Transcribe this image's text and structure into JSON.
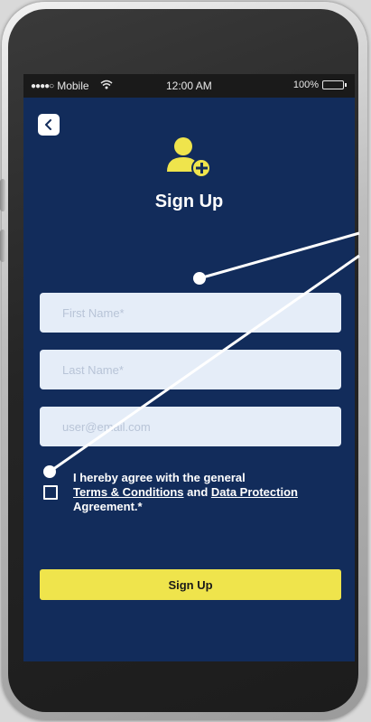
{
  "status_bar": {
    "carrier": "Mobile",
    "time": "12:00 AM",
    "battery": "100%"
  },
  "header": {
    "title": "Sign Up",
    "icon": "add-user-icon",
    "back_icon": "chevron-left-icon"
  },
  "form": {
    "first_name_placeholder": "First Name*",
    "last_name_placeholder": "Last Name*",
    "email_placeholder": "user@email.com",
    "agree_prefix": "I hereby agree with the general",
    "terms_link": "Terms & Conditions",
    "agree_and": " and ",
    "privacy_link": "Data Protection",
    "agree_suffix": "Agreement.*",
    "checkbox_checked": false
  },
  "actions": {
    "signup_label": "Sign Up"
  },
  "colors": {
    "screen_bg": "#122c5b",
    "accent": "#efe44c",
    "field_bg": "#e5edf8",
    "status_bar_bg": "#1a1a1a"
  }
}
